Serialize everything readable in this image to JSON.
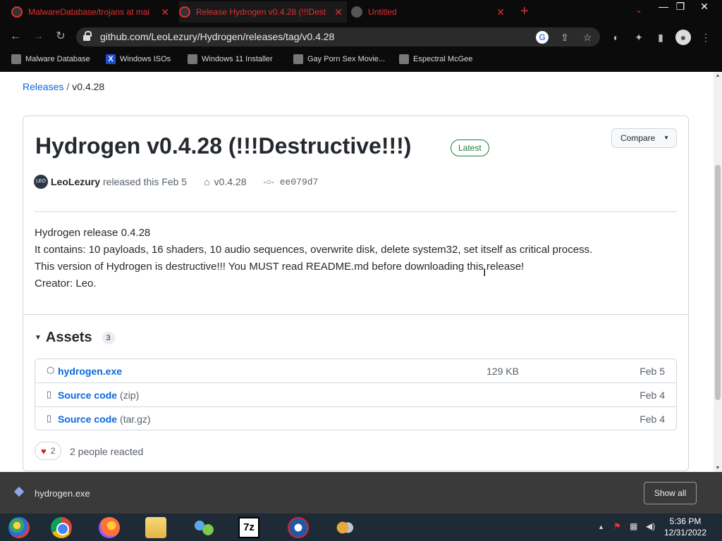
{
  "browser": {
    "tabs": [
      {
        "title": "MalwareDatabase/trojans at mai",
        "active": false
      },
      {
        "title": "Release Hydrogen v0.4.28 (!!!Dest",
        "active": true
      },
      {
        "title": "Untitled",
        "active": false
      }
    ],
    "new_tab": "+",
    "window_controls": {
      "minimize": "—",
      "maximize": "❐",
      "close": "✕"
    },
    "url": "github.com/LeoLezury/Hydrogen/releases/tag/v0.4.28",
    "bookmarks": [
      {
        "label": "Malware Database"
      },
      {
        "label": "Windows ISOs"
      },
      {
        "label": "Windows 11 Installer"
      },
      {
        "label": "Gay Porn Sex Movie..."
      },
      {
        "label": "Espectral McGee"
      }
    ]
  },
  "breadcrumb": {
    "parent": "Releases",
    "separator": "/",
    "current": "v0.4.28"
  },
  "release": {
    "title": "Hydrogen v0.4.28 (!!!Destructive!!!)",
    "badge": "Latest",
    "compare_label": "Compare",
    "avatar_text": "LEO",
    "author": "LeoLezury",
    "released_text": "released this Feb 5",
    "tag": "v0.4.28",
    "commit": "ee079d7",
    "body": [
      "Hydrogen release 0.4.28",
      "It contains: 10 payloads, 16 shaders, 10 audio sequences, overwrite disk, delete system32, set itself as critical process.",
      "This version of Hydrogen is destructive!!! You MUST read README.md before downloading this release!",
      "Creator: Leo."
    ]
  },
  "assets": {
    "title": "Assets",
    "count": "3",
    "items": [
      {
        "name": "hydrogen.exe",
        "suffix": "",
        "size": "129 KB",
        "date": "Feb 5",
        "icon": "package-icon"
      },
      {
        "name": "Source code",
        "suffix": "(zip)",
        "size": "",
        "date": "Feb 4",
        "icon": "file-zip-icon"
      },
      {
        "name": "Source code",
        "suffix": "(tar.gz)",
        "size": "",
        "date": "Feb 4",
        "icon": "file-zip-icon"
      }
    ]
  },
  "reactions": {
    "heart_count": "2",
    "summary": "2 people reacted"
  },
  "download_shelf": {
    "filename": "hydrogen.exe",
    "show_all": "Show all"
  },
  "taskbar": {
    "time": "5:36 PM",
    "date": "12/31/2022"
  },
  "colors": {
    "link": "#0969da",
    "latest_badge": "#1a7f37",
    "tab_text": "#e03030"
  }
}
